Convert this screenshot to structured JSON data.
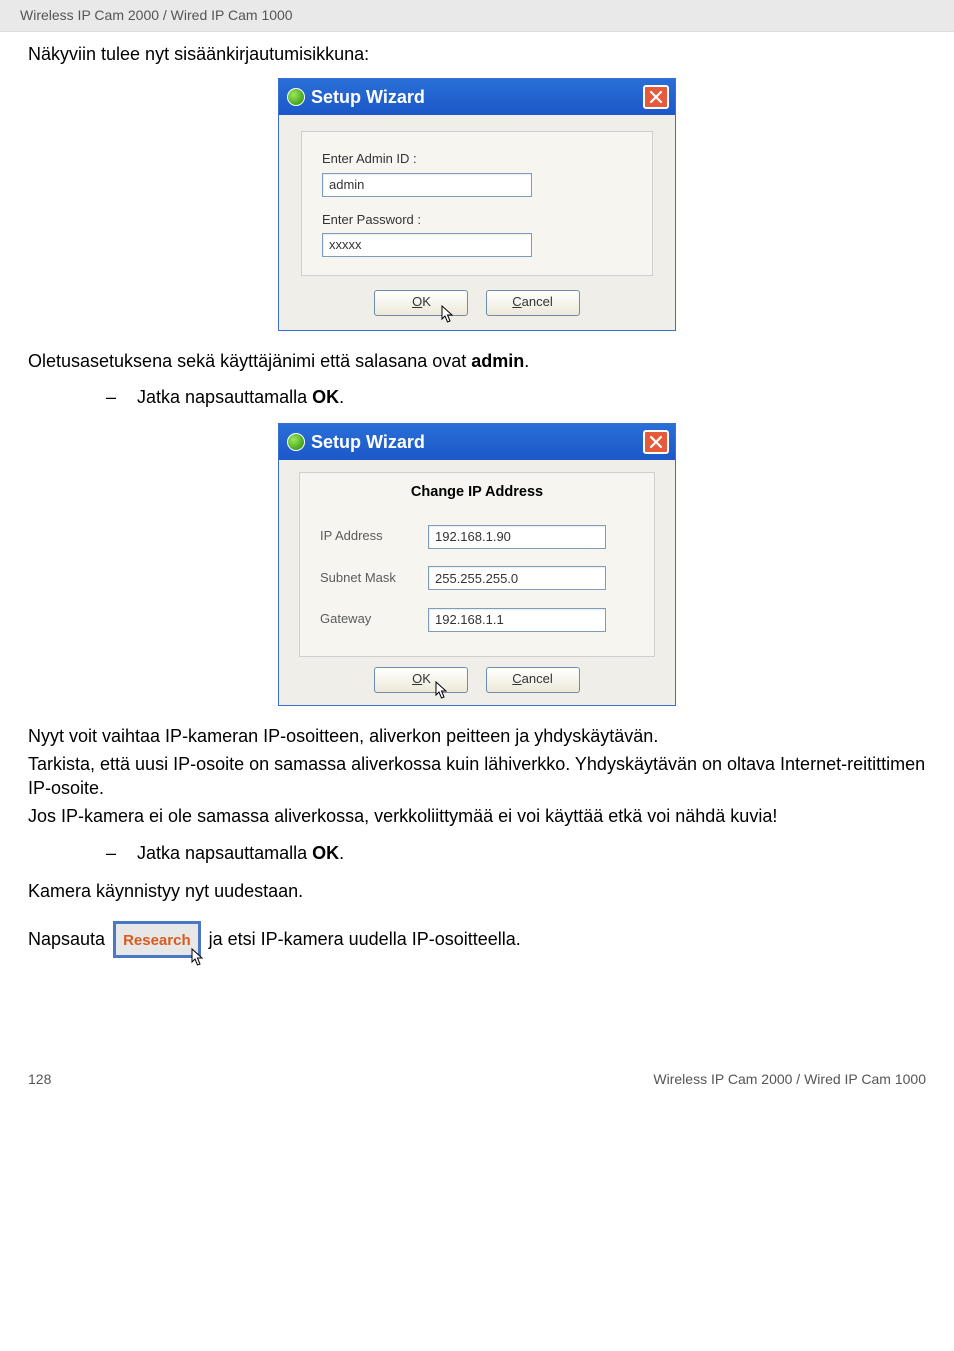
{
  "header": {
    "product_line": "Wireless IP Cam 2000 / Wired IP Cam 1000"
  },
  "text": {
    "intro": "Näkyviin tulee nyt sisäänkirjautumisikkuna:",
    "defaults_pre": "Oletusasetuksena sekä käyttäjänimi että salasana ovat ",
    "defaults_bold": "admin",
    "defaults_post": ".",
    "bullet1_pre": "Jatka napsauttamalla ",
    "bullet1_bold": "OK",
    "bullet1_post": ".",
    "para3_line1": "Nyyt voit vaihtaa IP-kameran IP-osoitteen, aliverkon peitteen ja yhdyskäytävän.",
    "para3_line2": "Tarkista, että uusi IP-osoite on samassa aliverkossa kuin lähiverkko. Yhdyskäytävän on oltava Internet-reitittimen IP-osoite.",
    "para3_line3": "Jos IP-kamera ei ole samassa aliverkossa, verkkoliittymää ei voi käyttää etkä voi nähdä kuvia!",
    "bullet2_pre": "Jatka napsauttamalla ",
    "bullet2_bold": "OK",
    "bullet2_post": ".",
    "restart": "Kamera käynnistyy nyt uudestaan.",
    "click_pre": "Napsauta",
    "click_post": "ja etsi IP-kamera uudella IP-osoitteella."
  },
  "dialog1": {
    "title": "Setup Wizard",
    "admin_label": "Enter Admin ID :",
    "admin_value": "admin",
    "password_label": "Enter Password :",
    "password_value": "xxxxx",
    "ok_label_u": "O",
    "ok_label_rest": "K",
    "cancel_label_u": "C",
    "cancel_label_rest": "ancel"
  },
  "dialog2": {
    "title": "Setup Wizard",
    "panel_title": "Change IP Address",
    "ip_label": "IP Address",
    "ip_value": "192.168.1.90",
    "subnet_label": "Subnet Mask",
    "subnet_value": "255.255.255.0",
    "gateway_label": "Gateway",
    "gateway_value": "192.168.1.1",
    "ok_label_u": "O",
    "ok_label_rest": "K",
    "cancel_label_u": "C",
    "cancel_label_rest": "ancel"
  },
  "research_button": {
    "label": "Research"
  },
  "footer": {
    "page": "128",
    "product_line": "Wireless IP Cam 2000 / Wired IP Cam 1000"
  }
}
